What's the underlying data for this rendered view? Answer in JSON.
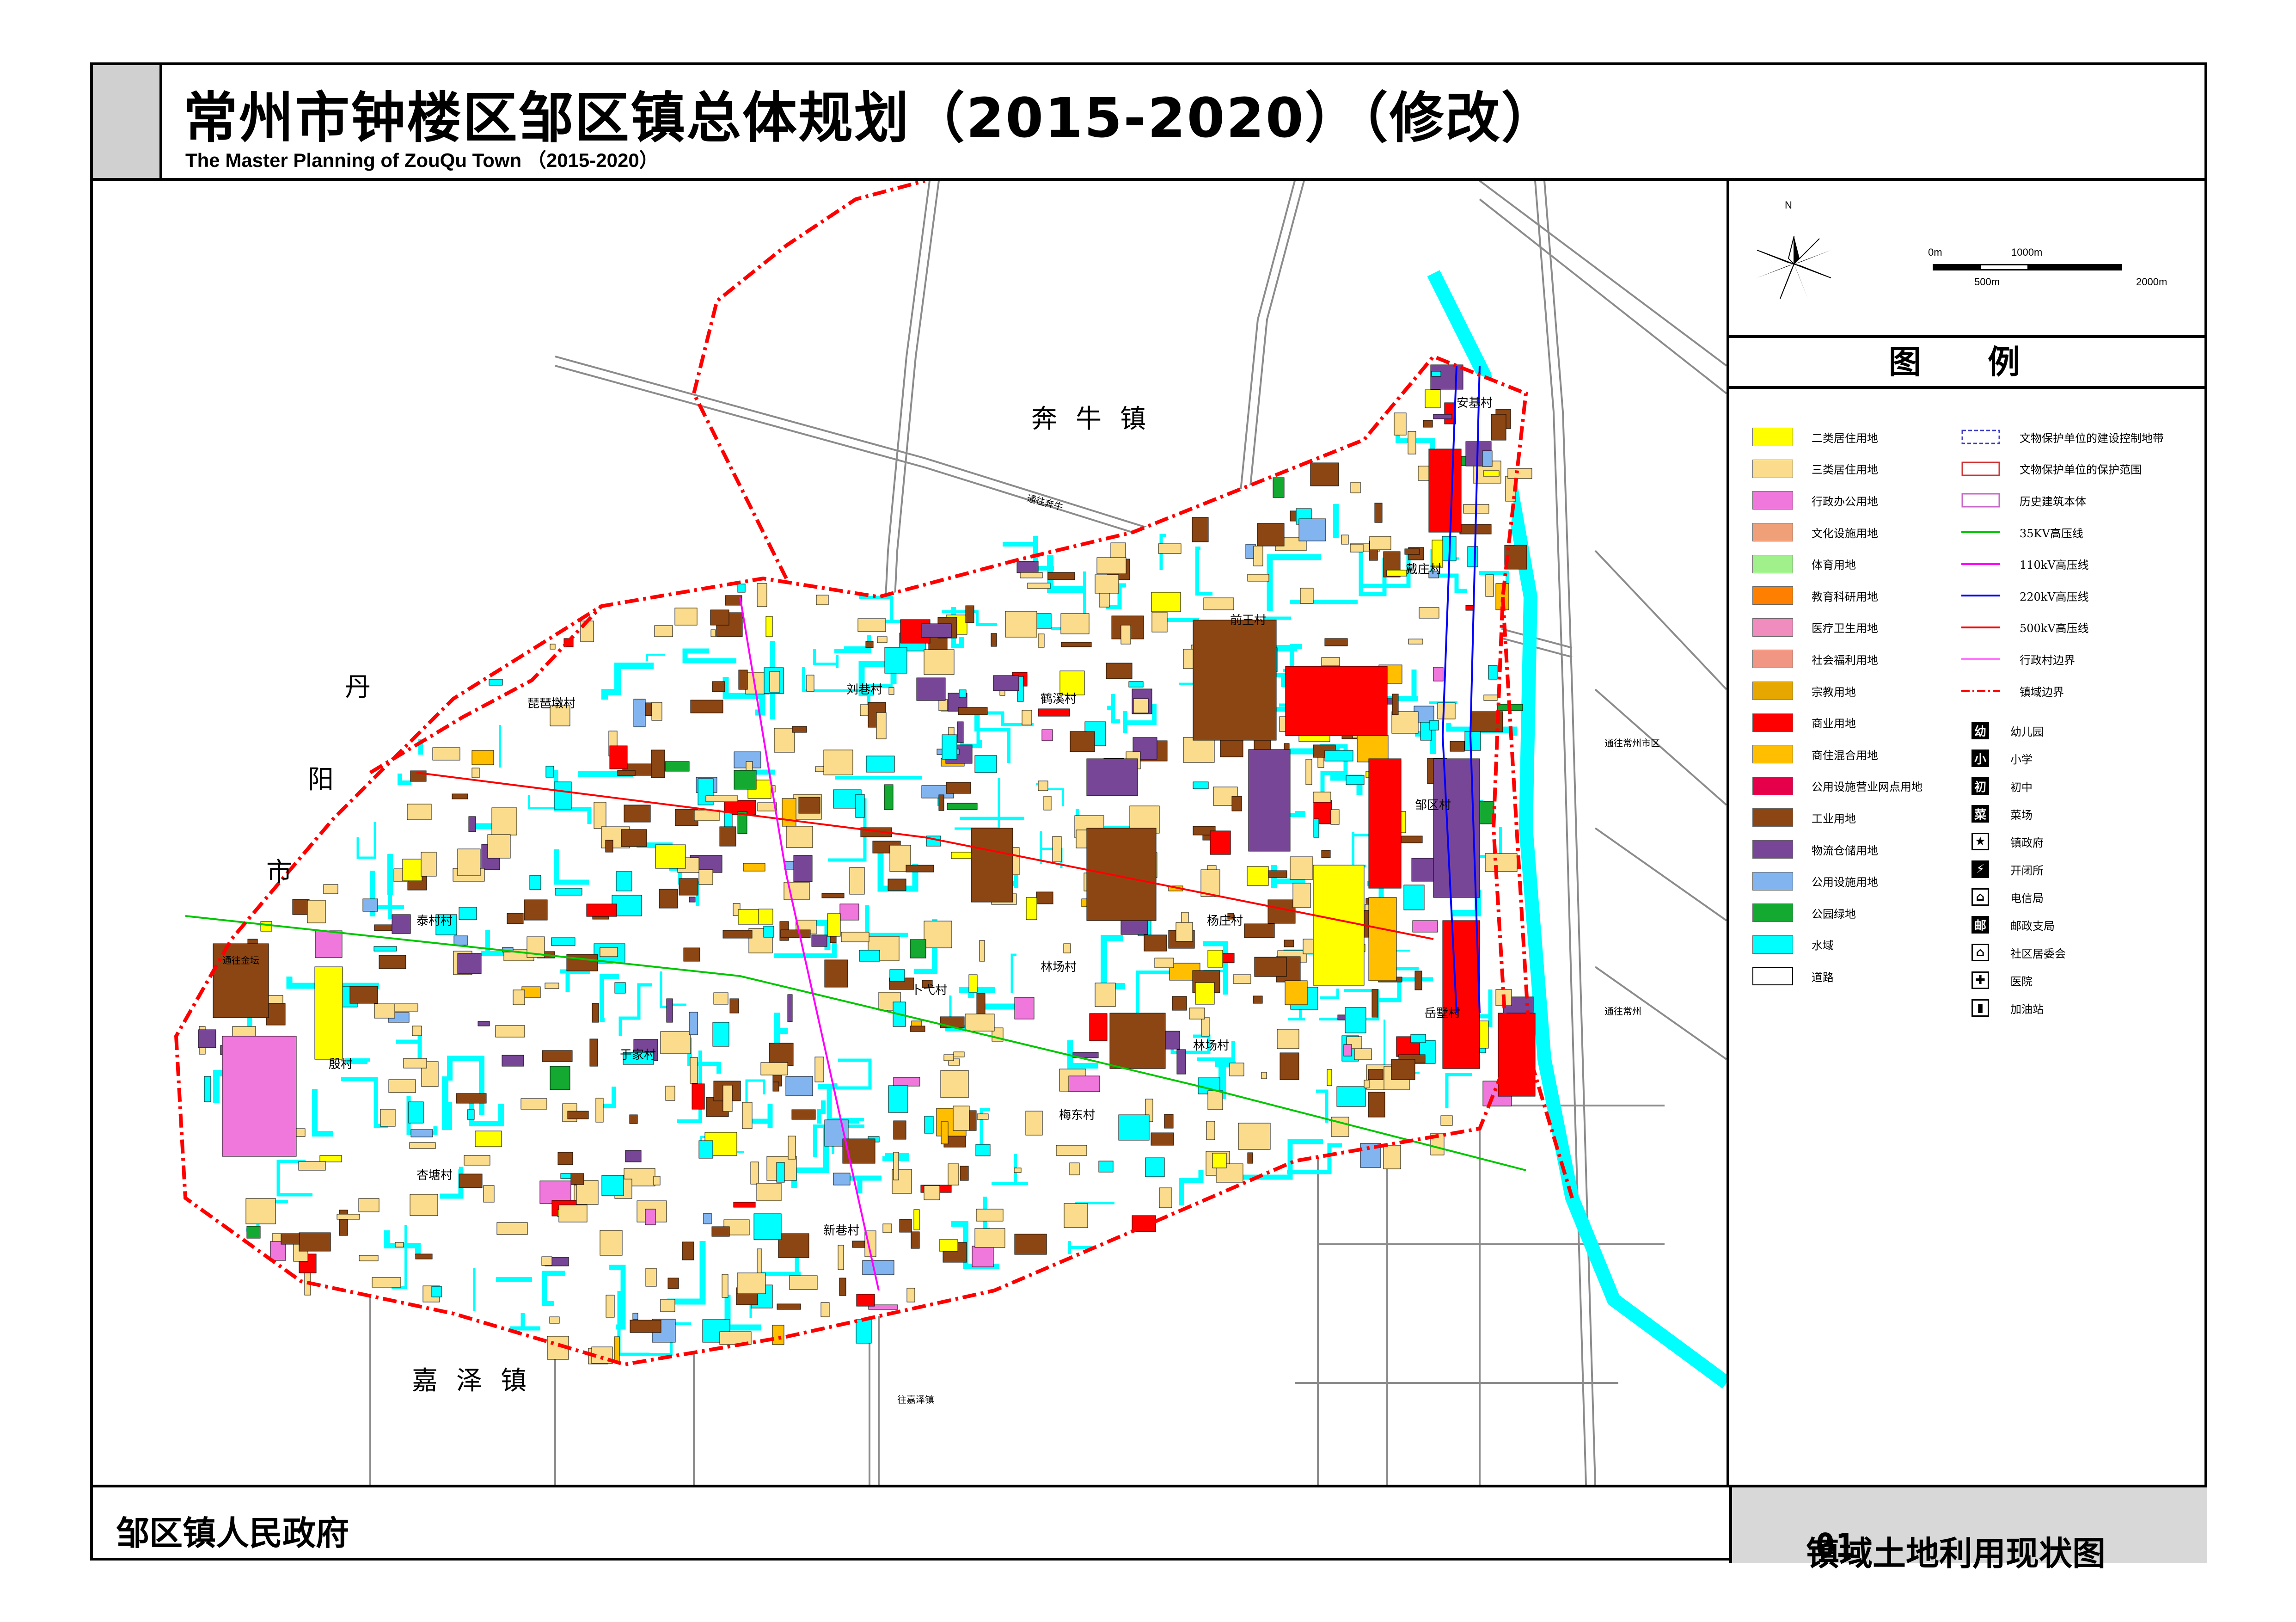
{
  "title": {
    "cn": "常州市钟楼区邹区镇总体规划（2015-2020）（修改）",
    "en": "The Master Planning of ZouQu Town （2015-2020）"
  },
  "compass": {
    "north_label": "N"
  },
  "scale_bar": {
    "top_labels": [
      "0m",
      "1000m"
    ],
    "bottom_labels": [
      "500m",
      "2000m"
    ]
  },
  "legend": {
    "heading": "图 例",
    "land_use": [
      {
        "label": "二类居住用地",
        "color": "#ffff00"
      },
      {
        "label": "三类居住用地",
        "color": "#fadc8c"
      },
      {
        "label": "行政办公用地",
        "color": "#f078dc"
      },
      {
        "label": "文化设施用地",
        "color": "#f0a078"
      },
      {
        "label": "体育用地",
        "color": "#a0f08c"
      },
      {
        "label": "教育科研用地",
        "color": "#ff8000"
      },
      {
        "label": "医疗卫生用地",
        "color": "#f08cbe"
      },
      {
        "label": "社会福利用地",
        "color": "#f09682"
      },
      {
        "label": "宗教用地",
        "color": "#e6a800"
      },
      {
        "label": "商业用地",
        "color": "#ff0000"
      },
      {
        "label": "商住混合用地",
        "color": "#ffbe00"
      },
      {
        "label": "公用设施营业网点用地",
        "color": "#e6004b"
      },
      {
        "label": "工业用地",
        "color": "#8c4614"
      },
      {
        "label": "物流仓储用地",
        "color": "#784696"
      },
      {
        "label": "公用设施用地",
        "color": "#82b4f0"
      },
      {
        "label": "公园绿地",
        "color": "#14aa32"
      },
      {
        "label": "水域",
        "color": "#00ffff"
      },
      {
        "label": "道路",
        "color": "#ffffff"
      }
    ],
    "lines": [
      {
        "label": "文物保护单位的建设控制地带",
        "color": "#3c3cc8",
        "style": "dashed-box"
      },
      {
        "label": "文物保护单位的保护范围",
        "color": "#d23232",
        "style": "box"
      },
      {
        "label": "历史建筑本体",
        "color": "#c864c8",
        "style": "box"
      },
      {
        "label": "35KV高压线",
        "color": "#00c800",
        "style": "line"
      },
      {
        "label": "110kV高压线",
        "color": "#ff00ff",
        "style": "line"
      },
      {
        "label": "220kV高压线",
        "color": "#0000ff",
        "style": "line"
      },
      {
        "label": "500kV高压线",
        "color": "#ff0000",
        "style": "line"
      },
      {
        "label": "行政村边界",
        "color": "#ff78ff",
        "style": "line"
      },
      {
        "label": "镇域边界",
        "color": "#ff0000",
        "style": "dashdot"
      }
    ],
    "facilities": [
      {
        "symbol": "幼",
        "label": "幼儿园",
        "icon": "kindergarten-icon"
      },
      {
        "symbol": "小",
        "label": "小学",
        "icon": "primary-school-icon"
      },
      {
        "symbol": "初",
        "label": "初中",
        "icon": "middle-school-icon"
      },
      {
        "symbol": "菜",
        "label": "菜场",
        "icon": "market-icon"
      },
      {
        "symbol": "★",
        "label": "镇政府",
        "icon": "star-icon"
      },
      {
        "symbol": "⚡",
        "label": "开闭所",
        "icon": "lightning-icon"
      },
      {
        "symbol": "⌂",
        "label": "电信局",
        "icon": "telecom-icon"
      },
      {
        "symbol": "邮",
        "label": "邮政支局",
        "icon": "post-icon"
      },
      {
        "symbol": "⌂",
        "label": "社区居委会",
        "icon": "community-icon"
      },
      {
        "symbol": "✚",
        "label": "医院",
        "icon": "hospital-icon"
      },
      {
        "symbol": "▮",
        "label": "加油站",
        "icon": "gas-station-icon"
      }
    ]
  },
  "map_labels": {
    "neighbors": [
      {
        "text": "奔牛镇"
      },
      {
        "text": "嘉泽镇"
      }
    ],
    "danyang": [
      "丹",
      "阳",
      "市"
    ],
    "villages": [
      {
        "text": "安基村"
      },
      {
        "text": "戴庄村"
      },
      {
        "text": "前王村"
      },
      {
        "text": "刘巷村"
      },
      {
        "text": "鹤溪村"
      },
      {
        "text": "琵琶墩村"
      },
      {
        "text": "邹区村"
      },
      {
        "text": "杨庄村"
      },
      {
        "text": "泰村村"
      },
      {
        "text": "林场村"
      },
      {
        "text": "卜弋村"
      },
      {
        "text": "林场村"
      },
      {
        "text": "岳墅村"
      },
      {
        "text": "于家村"
      },
      {
        "text": "梅东村"
      },
      {
        "text": "杏塘村"
      },
      {
        "text": "新巷村"
      },
      {
        "text": "殷村"
      }
    ],
    "roads": [
      {
        "text": "通往金坛"
      },
      {
        "text": "往嘉泽镇"
      },
      {
        "text": "通往奔牛"
      },
      {
        "text": "通往常州市区"
      },
      {
        "text": "通往常州"
      }
    ]
  },
  "footer": {
    "left": "邹区镇人民政府",
    "right": "镇域土地利用现状图",
    "sheet_no": "01"
  }
}
